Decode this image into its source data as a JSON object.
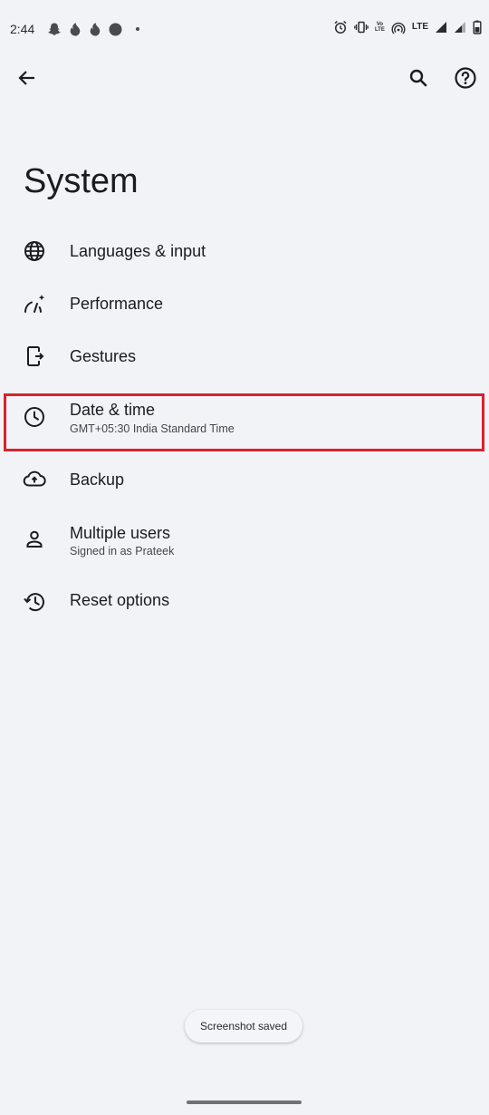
{
  "status_bar": {
    "time": "2:44",
    "notification_icons": [
      "snapchat-icon",
      "tinder-icon",
      "tinder-icon",
      "circle-app-icon",
      "dot-icon"
    ],
    "volte_label": "VoWiFi LTE",
    "lte_label": "LTE"
  },
  "toolbar": {
    "back_icon": "arrow-left-icon",
    "search_icon": "search-icon",
    "help_icon": "help-icon"
  },
  "page": {
    "title": "System"
  },
  "settings": [
    {
      "key": "languages",
      "title": "Languages & input",
      "summary": "",
      "icon": "globe-icon"
    },
    {
      "key": "performance",
      "title": "Performance",
      "summary": "",
      "icon": "performance-icon"
    },
    {
      "key": "gestures",
      "title": "Gestures",
      "summary": "",
      "icon": "gestures-icon"
    },
    {
      "key": "date_time",
      "title": "Date & time",
      "summary": "GMT+05:30 India Standard Time",
      "icon": "clock-icon"
    },
    {
      "key": "backup",
      "title": "Backup",
      "summary": "",
      "icon": "cloud-upload-icon"
    },
    {
      "key": "multiple_users",
      "title": "Multiple users",
      "summary": "Signed in as Prateek",
      "icon": "person-icon"
    },
    {
      "key": "reset",
      "title": "Reset options",
      "summary": "",
      "icon": "reset-icon"
    }
  ],
  "highlight": {
    "color": "#d8232e",
    "target": "Date & time"
  },
  "toast": {
    "message": "Screenshot saved"
  }
}
